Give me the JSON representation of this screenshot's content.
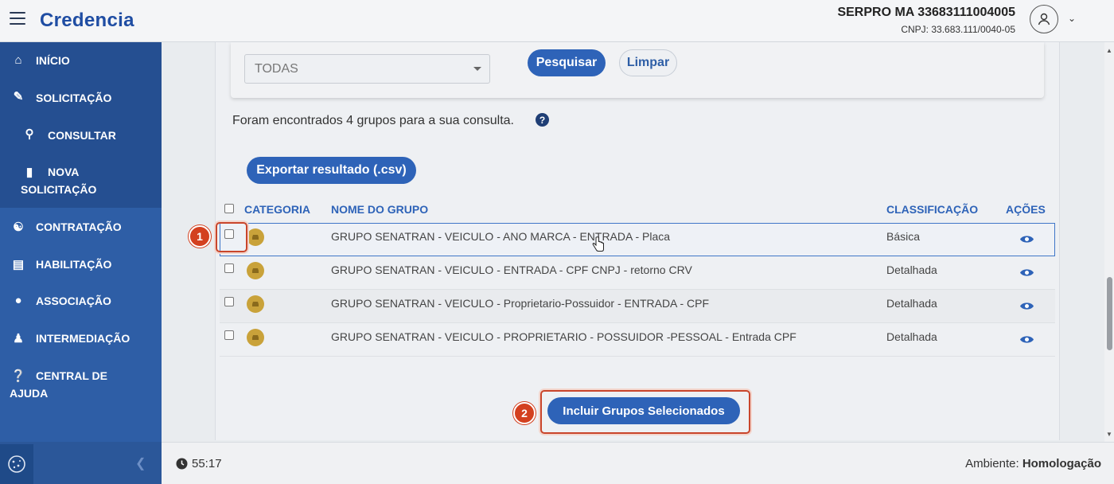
{
  "header": {
    "logo": "Credencia",
    "org_name": "SERPRO MA 33683111004005",
    "org_cnpj": "CNPJ: 33.683.111/0040-05"
  },
  "sidebar": {
    "items": [
      {
        "label": "INÍCIO",
        "icon": "home-icon"
      },
      {
        "label": "SOLICITAÇÃO",
        "icon": "edit-icon"
      },
      {
        "label": "CONSULTAR",
        "icon": "search-icon"
      },
      {
        "label_line1": "NOVA",
        "label_line2": "SOLICITAÇÃO",
        "icon": "file-icon"
      },
      {
        "label": "CONTRATAÇÃO",
        "icon": "handshake-icon"
      },
      {
        "label": "HABILITAÇÃO",
        "icon": "id-card-icon"
      },
      {
        "label": "ASSOCIAÇÃO",
        "icon": "users-icon"
      },
      {
        "label": "INTERMEDIAÇÃO",
        "icon": "user-tie-icon"
      },
      {
        "label_line1": "CENTRAL DE",
        "label_line2": "AJUDA",
        "icon": "question-icon"
      }
    ]
  },
  "filter": {
    "classification_value": "TODAS",
    "search_label": "Pesquisar",
    "clear_label": "Limpar"
  },
  "results": {
    "summary": "Foram encontrados 4 grupos para a sua consulta.",
    "export_label": "Exportar resultado (.csv)"
  },
  "table": {
    "headers": {
      "category": "CATEGORIA",
      "group_name": "NOME DO GRUPO",
      "classification": "CLASSIFICAÇÃO",
      "actions": "AÇÕES"
    },
    "rows": [
      {
        "name": "GRUPO SENATRAN - VEICULO - ANO MARCA - ENTRADA - Placa",
        "classification": "Básica"
      },
      {
        "name": "GRUPO SENATRAN - VEICULO - ENTRADA - CPF CNPJ - retorno CRV",
        "classification": "Detalhada"
      },
      {
        "name": "GRUPO SENATRAN - VEICULO - Proprietario-Possuidor - ENTRADA - CPF",
        "classification": "Detalhada"
      },
      {
        "name": "GRUPO SENATRAN - VEICULO - PROPRIETARIO - POSSUIDOR -PESSOAL - Entrada CPF",
        "classification": "Detalhada"
      }
    ]
  },
  "include_button_label": "Incluir Grupos Selecionados",
  "annotations": {
    "step1": "1",
    "step2": "2"
  },
  "footer": {
    "timer": "55:17",
    "env_label": "Ambiente:",
    "env_value": "Homologação"
  },
  "colors": {
    "sidebar": "#2e5ea6",
    "primary": "#2e63b8",
    "annotation": "#d3401f",
    "category_icon": "#c9a23a"
  }
}
